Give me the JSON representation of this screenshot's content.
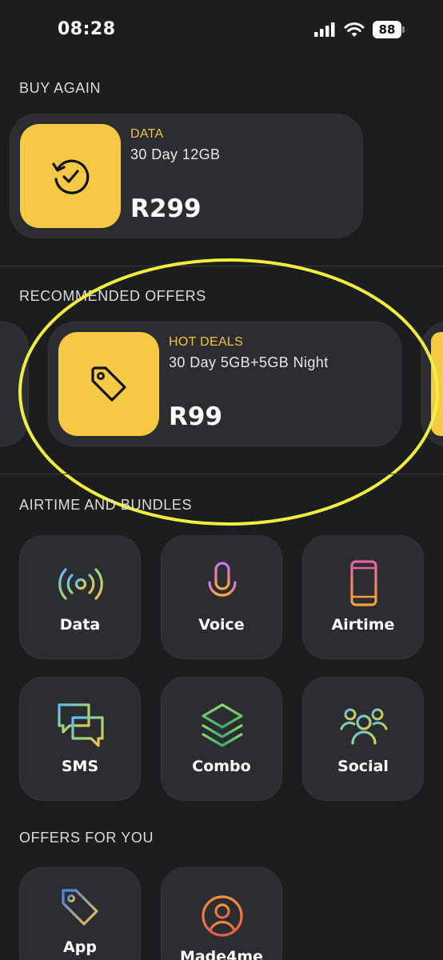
{
  "status_bar": {
    "time": "08:28",
    "battery": "88"
  },
  "sections": {
    "buy_again": "BUY AGAIN",
    "recommended": "RECOMMENDED OFFERS",
    "airtime_bundles": "AIRTIME AND BUNDLES",
    "offers_for_you": "OFFERS FOR YOU"
  },
  "buy_again_card": {
    "category": "DATA",
    "name": "30 Day 12GB",
    "price": "R299",
    "icon": "repeat-check-icon"
  },
  "recommended_card": {
    "category": "HOT DEALS",
    "name": "30 Day 5GB+5GB Night",
    "price": "R99",
    "icon": "price-tag-icon"
  },
  "bundles": [
    {
      "label": "Data",
      "icon": "signal-broadcast-icon"
    },
    {
      "label": "Voice",
      "icon": "microphone-icon"
    },
    {
      "label": "Airtime",
      "icon": "phone-icon"
    },
    {
      "label": "SMS",
      "icon": "chat-bubbles-icon"
    },
    {
      "label": "Combo",
      "icon": "layers-icon"
    },
    {
      "label": "Social",
      "icon": "group-icon"
    }
  ],
  "offers_for_you": [
    {
      "label": "App",
      "icon": "tag-icon"
    },
    {
      "label": "Made4me",
      "icon": "user-circle-icon"
    }
  ],
  "colors": {
    "background": "#1c1d1f",
    "card": "#2c2d30",
    "accent_yellow": "#f6c945",
    "highlight": "#f2ee3c"
  }
}
